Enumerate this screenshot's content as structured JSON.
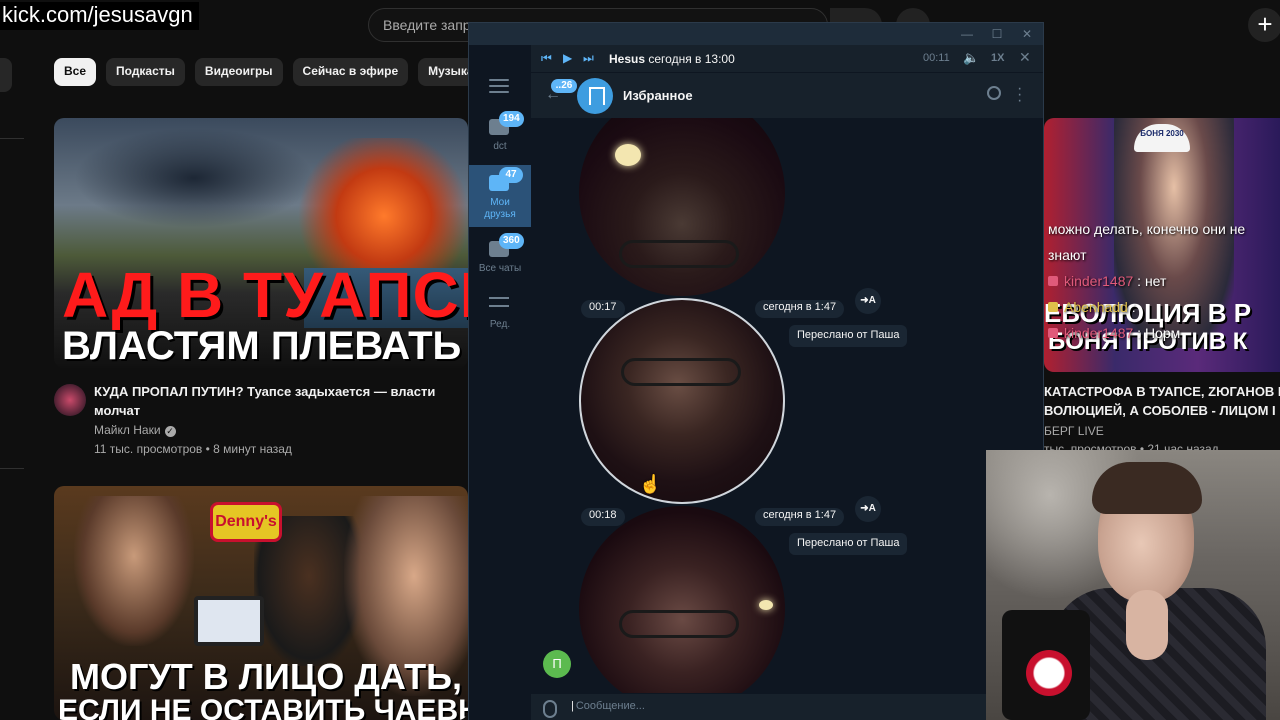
{
  "overlay": {
    "url": "kick.com/jesusavgn"
  },
  "youtube": {
    "search_placeholder": "Введите запрос",
    "chips": [
      "Все",
      "Подкасты",
      "Видеоигры",
      "Сейчас в эфире",
      "Музыка"
    ],
    "video1": {
      "thumb_line1": "АД В ТУАПСЕ",
      "thumb_line2": "ВЛАСТЯМ ПЛЕВАТЬ",
      "title": "КУДА ПРОПАЛ ПУТИН? Туапсе задыхается — власти молчат",
      "channel": "Майкл Наки",
      "meta": "11 тыс. просмотров • 8 минут назад"
    },
    "video2": {
      "sign": "Denny's",
      "thumb_line1": "МОГУТ В ЛИЦО ДАТЬ,",
      "thumb_line2": "ЕСЛИ НЕ ОСТАВИТЬ ЧАЕВЫЕ?"
    },
    "video3": {
      "cap_text": "БОНЯ 2030",
      "thumb_line1": "ЕВОЛЮЦИЯ В Р",
      "thumb_line2": "БОНЯ ПРОТИВ К",
      "title": "КАТАСТРОФА В ТУАПСЕ, ZЮГАНОВ Г",
      "title2": "ВОЛЮЦИЕЙ, А СОБОЛЕВ - ЛИЦОМ І М",
      "channel": "БЕРГ LIVE",
      "meta": "тыс. просмотров • 21 час назад"
    }
  },
  "stream_chat": [
    {
      "user": "",
      "text": "можно делать, конечно они не"
    },
    {
      "user": "",
      "text": "знают"
    },
    {
      "user": "kinder1487",
      "text": ": нет"
    },
    {
      "user": "Abenhadd",
      "text": ":"
    },
    {
      "user": "kinder1487",
      "text": ": Норм"
    }
  ],
  "telegram": {
    "folders": [
      {
        "label": "dct",
        "badge": "194"
      },
      {
        "label": "Мои друзья",
        "badge": "47"
      },
      {
        "label": "Все чаты",
        "badge": "360"
      },
      {
        "label": "Ред.",
        "badge": ""
      }
    ],
    "player": {
      "prev": "⏮",
      "play": "▶",
      "next": "⏭",
      "sender": "Hesus",
      "when": "сегодня в 13:00",
      "time": "00:11",
      "speed": "1X",
      "close": "✕"
    },
    "header": {
      "back_badge": "..26",
      "chat_name": "Избранное"
    },
    "messages": [
      {
        "duration": "00:17",
        "date": "сегодня в 1:47",
        "fwd_label": "➜A",
        "forwarded_from": "Переслано от Паша"
      },
      {
        "duration": "00:18",
        "date": "сегодня в 1:47",
        "fwd_label": "➜A",
        "forwarded_from": "Переслано от Паша"
      }
    ],
    "sender_initial": "П",
    "compose_placeholder": "Сообщение..."
  }
}
